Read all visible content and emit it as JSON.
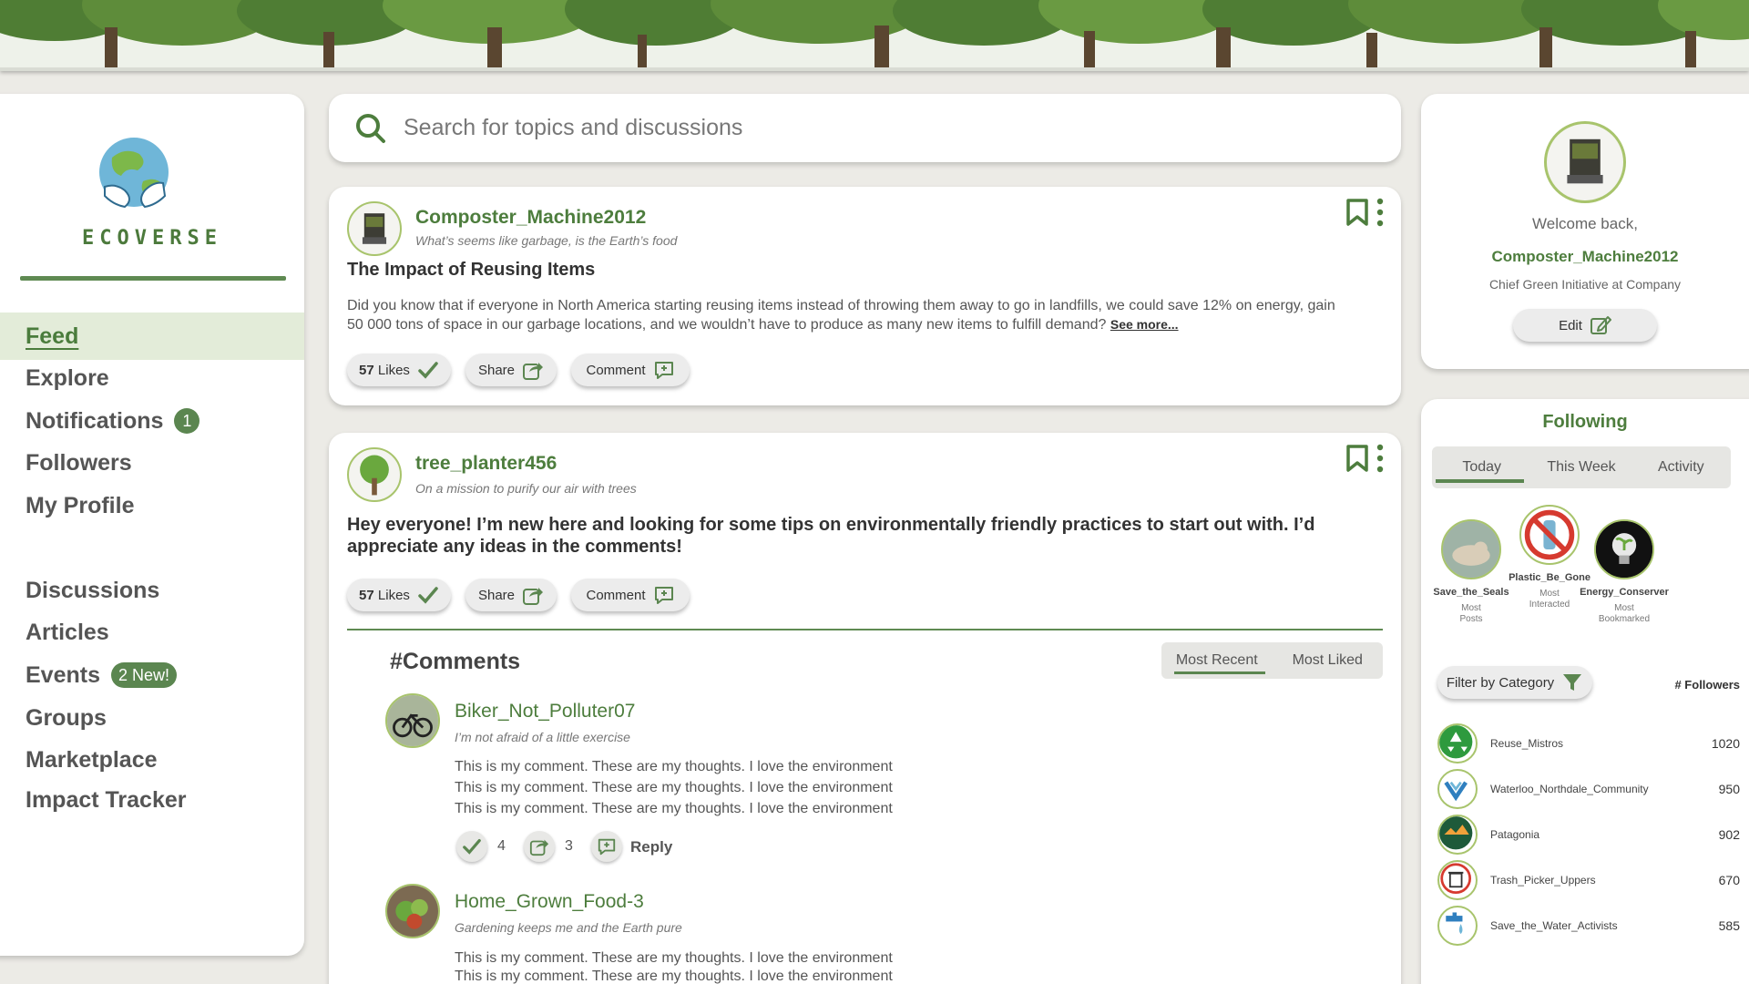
{
  "brand": {
    "name": "ECOVERSE"
  },
  "nav": {
    "items": [
      {
        "label": "Feed",
        "badge": ""
      },
      {
        "label": "Explore",
        "badge": ""
      },
      {
        "label": "Notifications",
        "badge": "1"
      },
      {
        "label": "Followers",
        "badge": ""
      },
      {
        "label": "My Profile",
        "badge": ""
      },
      {
        "label": "Discussions",
        "badge": ""
      },
      {
        "label": "Articles",
        "badge": ""
      },
      {
        "label": "Events",
        "badge": "2 New!"
      },
      {
        "label": "Groups",
        "badge": ""
      },
      {
        "label": "Marketplace",
        "badge": ""
      },
      {
        "label": "Impact Tracker",
        "badge": ""
      }
    ]
  },
  "search": {
    "placeholder": "Search for topics and discussions"
  },
  "posts": [
    {
      "username": "Composter_Machine2012",
      "tagline": "What’s seems like garbage, is the Earth’s food",
      "title": "The Impact of Reusing Items",
      "body": "Did you know that if everyone in North America starting reusing items instead of throwing them away to go in landfills, we could save 12% on energy, gain 50 000 tons of space in our garbage locations, and we wouldn’t have to produce as many new items to fulfill demand?",
      "see_more": "See more...",
      "likes_count": "57",
      "likes_label": "Likes",
      "share_label": "Share",
      "comment_label": "Comment"
    },
    {
      "username": "tree_planter456",
      "tagline": "On a mission to purify our air with trees",
      "body": "Hey everyone! I’m new here and looking for some tips on environmentally friendly practices to start out with. I’d appreciate any ideas in the comments!",
      "likes_count": "57",
      "likes_label": "Likes",
      "share_label": "Share",
      "comment_label": "Comment"
    }
  ],
  "comments": {
    "title": "#Comments",
    "sort_options": [
      "Most Recent",
      "Most Liked"
    ],
    "items": [
      {
        "username": "Biker_Not_Polluter07",
        "tagline": "I’m not afraid of a little exercise",
        "lines": [
          "This is my comment. These are my thoughts. I love the environment",
          "This is my comment. These are my thoughts. I love the environment",
          "This is my comment. These are my thoughts. I love the environment"
        ],
        "likes": "4",
        "shares": "3",
        "reply_label": "Reply"
      },
      {
        "username": "Home_Grown_Food-3",
        "tagline": "Gardening keeps me and the Earth pure",
        "lines": [
          "This is my comment. These are my thoughts. I love the environment",
          "This is my comment. These are my thoughts. I love the environment"
        ]
      }
    ]
  },
  "profile": {
    "welcome": "Welcome back,",
    "name": "Composter_Machine2012",
    "role": "Chief Green Initiative at Company",
    "edit_label": "Edit"
  },
  "following": {
    "title": "Following",
    "tabs": [
      "Today",
      "This Week",
      "Activity"
    ],
    "top_accounts": [
      {
        "name": "Save_the_Seals",
        "label_line1": "Most",
        "label_line2": "Posts"
      },
      {
        "name": "Plastic_Be_Gone",
        "label_line1": "Most",
        "label_line2": "Interacted"
      },
      {
        "name": "Energy_Conserver",
        "label_line1": "Most",
        "label_line2": "Bookmarked"
      }
    ],
    "filter_label": "Filter by Category",
    "followers_header": "# Followers",
    "accounts": [
      {
        "name": "Reuse_Mistros",
        "count": "1020"
      },
      {
        "name": "Waterloo_Northdale_Community",
        "count": "950"
      },
      {
        "name": "Patagonia",
        "count": "902"
      },
      {
        "name": "Trash_Picker_Uppers",
        "count": "670"
      },
      {
        "name": "Save_the_Water_Activists",
        "count": "585"
      }
    ]
  },
  "colors": {
    "brand_green": "#4d7d3d",
    "accent_light": "#e3ecd9",
    "badge_green": "#5b8650"
  }
}
